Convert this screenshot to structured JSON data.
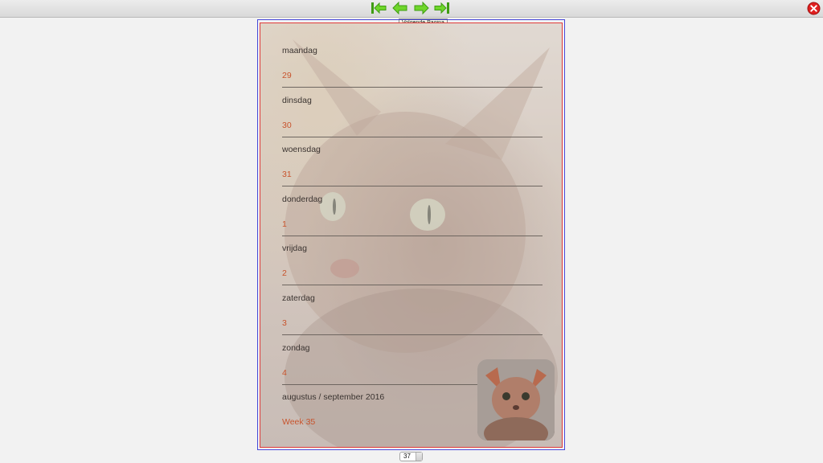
{
  "toolbar": {
    "buttons": [
      {
        "name": "first-page-icon"
      },
      {
        "name": "previous-page-icon"
      },
      {
        "name": "next-page-icon"
      },
      {
        "name": "last-page-icon"
      }
    ],
    "tooltip": "Volgende Pagina",
    "close_icon": "close-icon",
    "accent": "#5cc41c",
    "close_color": "#e02020"
  },
  "page": {
    "days": [
      {
        "label": "maandag",
        "num": "29"
      },
      {
        "label": "dinsdag",
        "num": "30"
      },
      {
        "label": "woensdag",
        "num": "31"
      },
      {
        "label": "donderdag",
        "num": "1"
      },
      {
        "label": "vrijdag",
        "num": "2"
      },
      {
        "label": "zaterdag",
        "num": "3"
      },
      {
        "label": "zondag",
        "num": "4"
      }
    ],
    "month": "augustus / september 2016",
    "week": "Week 35",
    "label_color": "#3a3330",
    "number_color": "#c8532c"
  },
  "pager": {
    "current_page": "37"
  }
}
